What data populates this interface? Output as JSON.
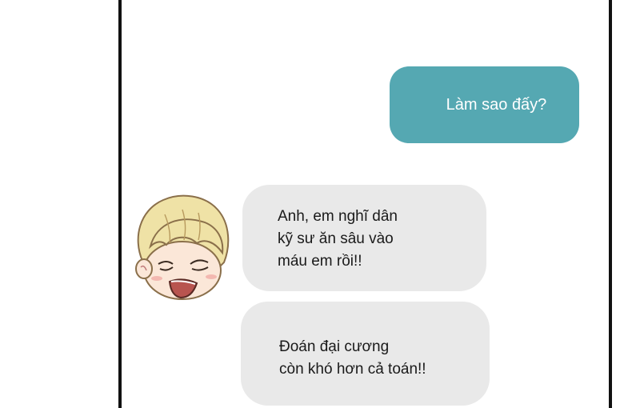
{
  "chat": {
    "messages": [
      {
        "sender": "me",
        "lines": [
          "Làm sao đấy?"
        ]
      },
      {
        "sender": "other",
        "lines": [
          "Anh, em nghĩ dân",
          "kỹ sư ăn sâu vào",
          "máu em rồi!!"
        ]
      },
      {
        "sender": "other",
        "lines": [
          "Đoán đại cương",
          "còn khó hơn cả toán!!"
        ]
      }
    ]
  },
  "colors": {
    "sent_bubble": "#55a8b2",
    "received_bubble": "#e9e9e9",
    "frame": "#111111"
  },
  "icons": {
    "avatar": "chibi-boy-avatar-icon"
  }
}
